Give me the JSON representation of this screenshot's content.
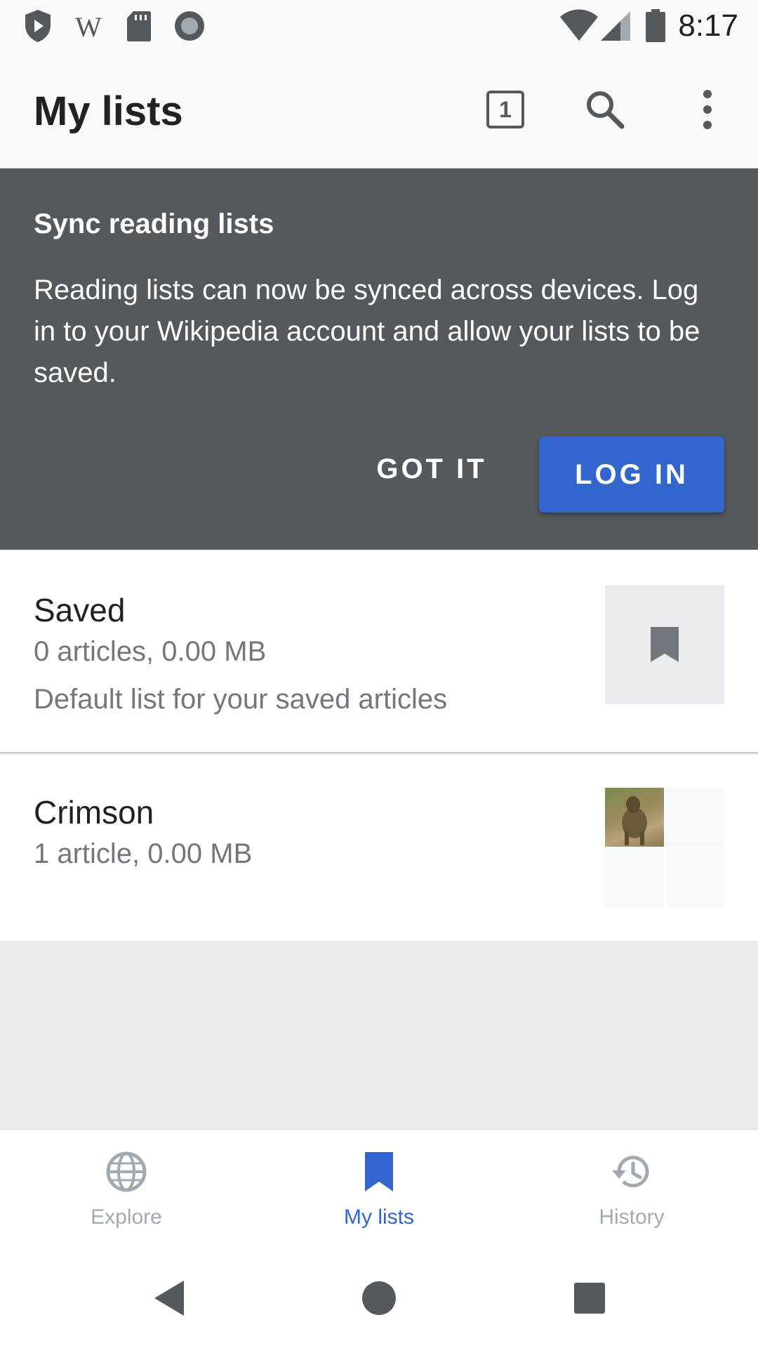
{
  "status_bar": {
    "time": "8:17",
    "left_icons": [
      "play-shield-icon",
      "wikipedia-w-icon",
      "sd-card-icon",
      "circle-record-icon"
    ],
    "right_icons": [
      "wifi-icon",
      "cell-signal-icon",
      "battery-icon"
    ]
  },
  "app_bar": {
    "title": "My lists",
    "tabs_count": "1",
    "icons": [
      "tabs-icon",
      "search-icon",
      "more-vert-icon"
    ]
  },
  "sync_card": {
    "title": "Sync reading lists",
    "body": "Reading lists can now be synced across devices. Log in to your Wikipedia account and allow your lists to be saved.",
    "got_it_label": "GOT IT",
    "log_in_label": "LOG IN"
  },
  "lists": [
    {
      "title": "Saved",
      "meta": "0 articles, 0.00 MB",
      "description": "Default list for your saved articles",
      "thumb_icon": "bookmark-icon"
    },
    {
      "title": "Crimson",
      "meta": "1 article, 0.00 MB",
      "thumb_icon": "baboon-photo"
    }
  ],
  "bottom_nav": {
    "items": [
      {
        "label": "Explore",
        "icon": "globe-icon",
        "active": false
      },
      {
        "label": "My lists",
        "icon": "bookmark-icon",
        "active": true
      },
      {
        "label": "History",
        "icon": "history-icon",
        "active": false
      }
    ]
  },
  "system_nav": [
    "back-icon",
    "home-icon",
    "recents-icon"
  ],
  "colors": {
    "accent": "#3366cc",
    "card_bg": "#54595d",
    "text_primary": "#202122",
    "text_secondary": "#72777d"
  }
}
